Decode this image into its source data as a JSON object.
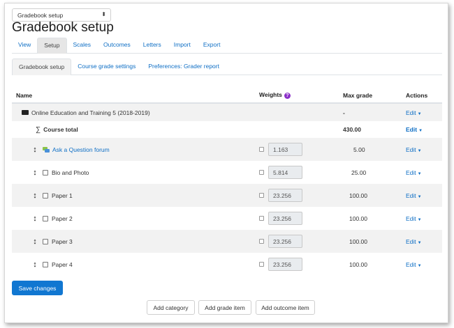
{
  "jump": {
    "selected": "Gradebook setup",
    "arrow": "⬍"
  },
  "page_title": "Gradebook setup",
  "main_tabs": [
    {
      "label": "View",
      "active": false
    },
    {
      "label": "Setup",
      "active": true
    },
    {
      "label": "Scales",
      "active": false
    },
    {
      "label": "Outcomes",
      "active": false
    },
    {
      "label": "Letters",
      "active": false
    },
    {
      "label": "Import",
      "active": false
    },
    {
      "label": "Export",
      "active": false
    }
  ],
  "sub_tabs": [
    {
      "label": "Gradebook setup",
      "active": true
    },
    {
      "label": "Course grade settings",
      "active": false
    },
    {
      "label": "Preferences: Grader report",
      "active": false
    }
  ],
  "table": {
    "headers": {
      "name": "Name",
      "weights": "Weights",
      "max": "Max grade",
      "actions": "Actions"
    },
    "help_icon": "?",
    "category": {
      "name": "Online Education and Training 5 (2018-2019)",
      "max": "-",
      "edit": "Edit"
    },
    "course_total": {
      "sigma": "∑",
      "name": "Course total",
      "max": "430.00",
      "edit": "Edit"
    },
    "items": [
      {
        "name": "Ask a Question forum",
        "weight": "1.163",
        "max": "5.00",
        "edit": "Edit",
        "link": true
      },
      {
        "name": "Bio and Photo",
        "weight": "5.814",
        "max": "25.00",
        "edit": "Edit",
        "link": false
      },
      {
        "name": "Paper 1",
        "weight": "23.256",
        "max": "100.00",
        "edit": "Edit",
        "link": false
      },
      {
        "name": "Paper 2",
        "weight": "23.256",
        "max": "100.00",
        "edit": "Edit",
        "link": false
      },
      {
        "name": "Paper 3",
        "weight": "23.256",
        "max": "100.00",
        "edit": "Edit",
        "link": false
      },
      {
        "name": "Paper 4",
        "weight": "23.256",
        "max": "100.00",
        "edit": "Edit",
        "link": false
      }
    ],
    "move_glyph": "↕",
    "caret": "▼"
  },
  "buttons": {
    "save": "Save changes",
    "add_category": "Add category",
    "add_grade_item": "Add grade item",
    "add_outcome_item": "Add outcome item"
  },
  "colors": {
    "link": "#0f6fc5",
    "primary": "#1177d1",
    "help": "#8b2fc9"
  }
}
